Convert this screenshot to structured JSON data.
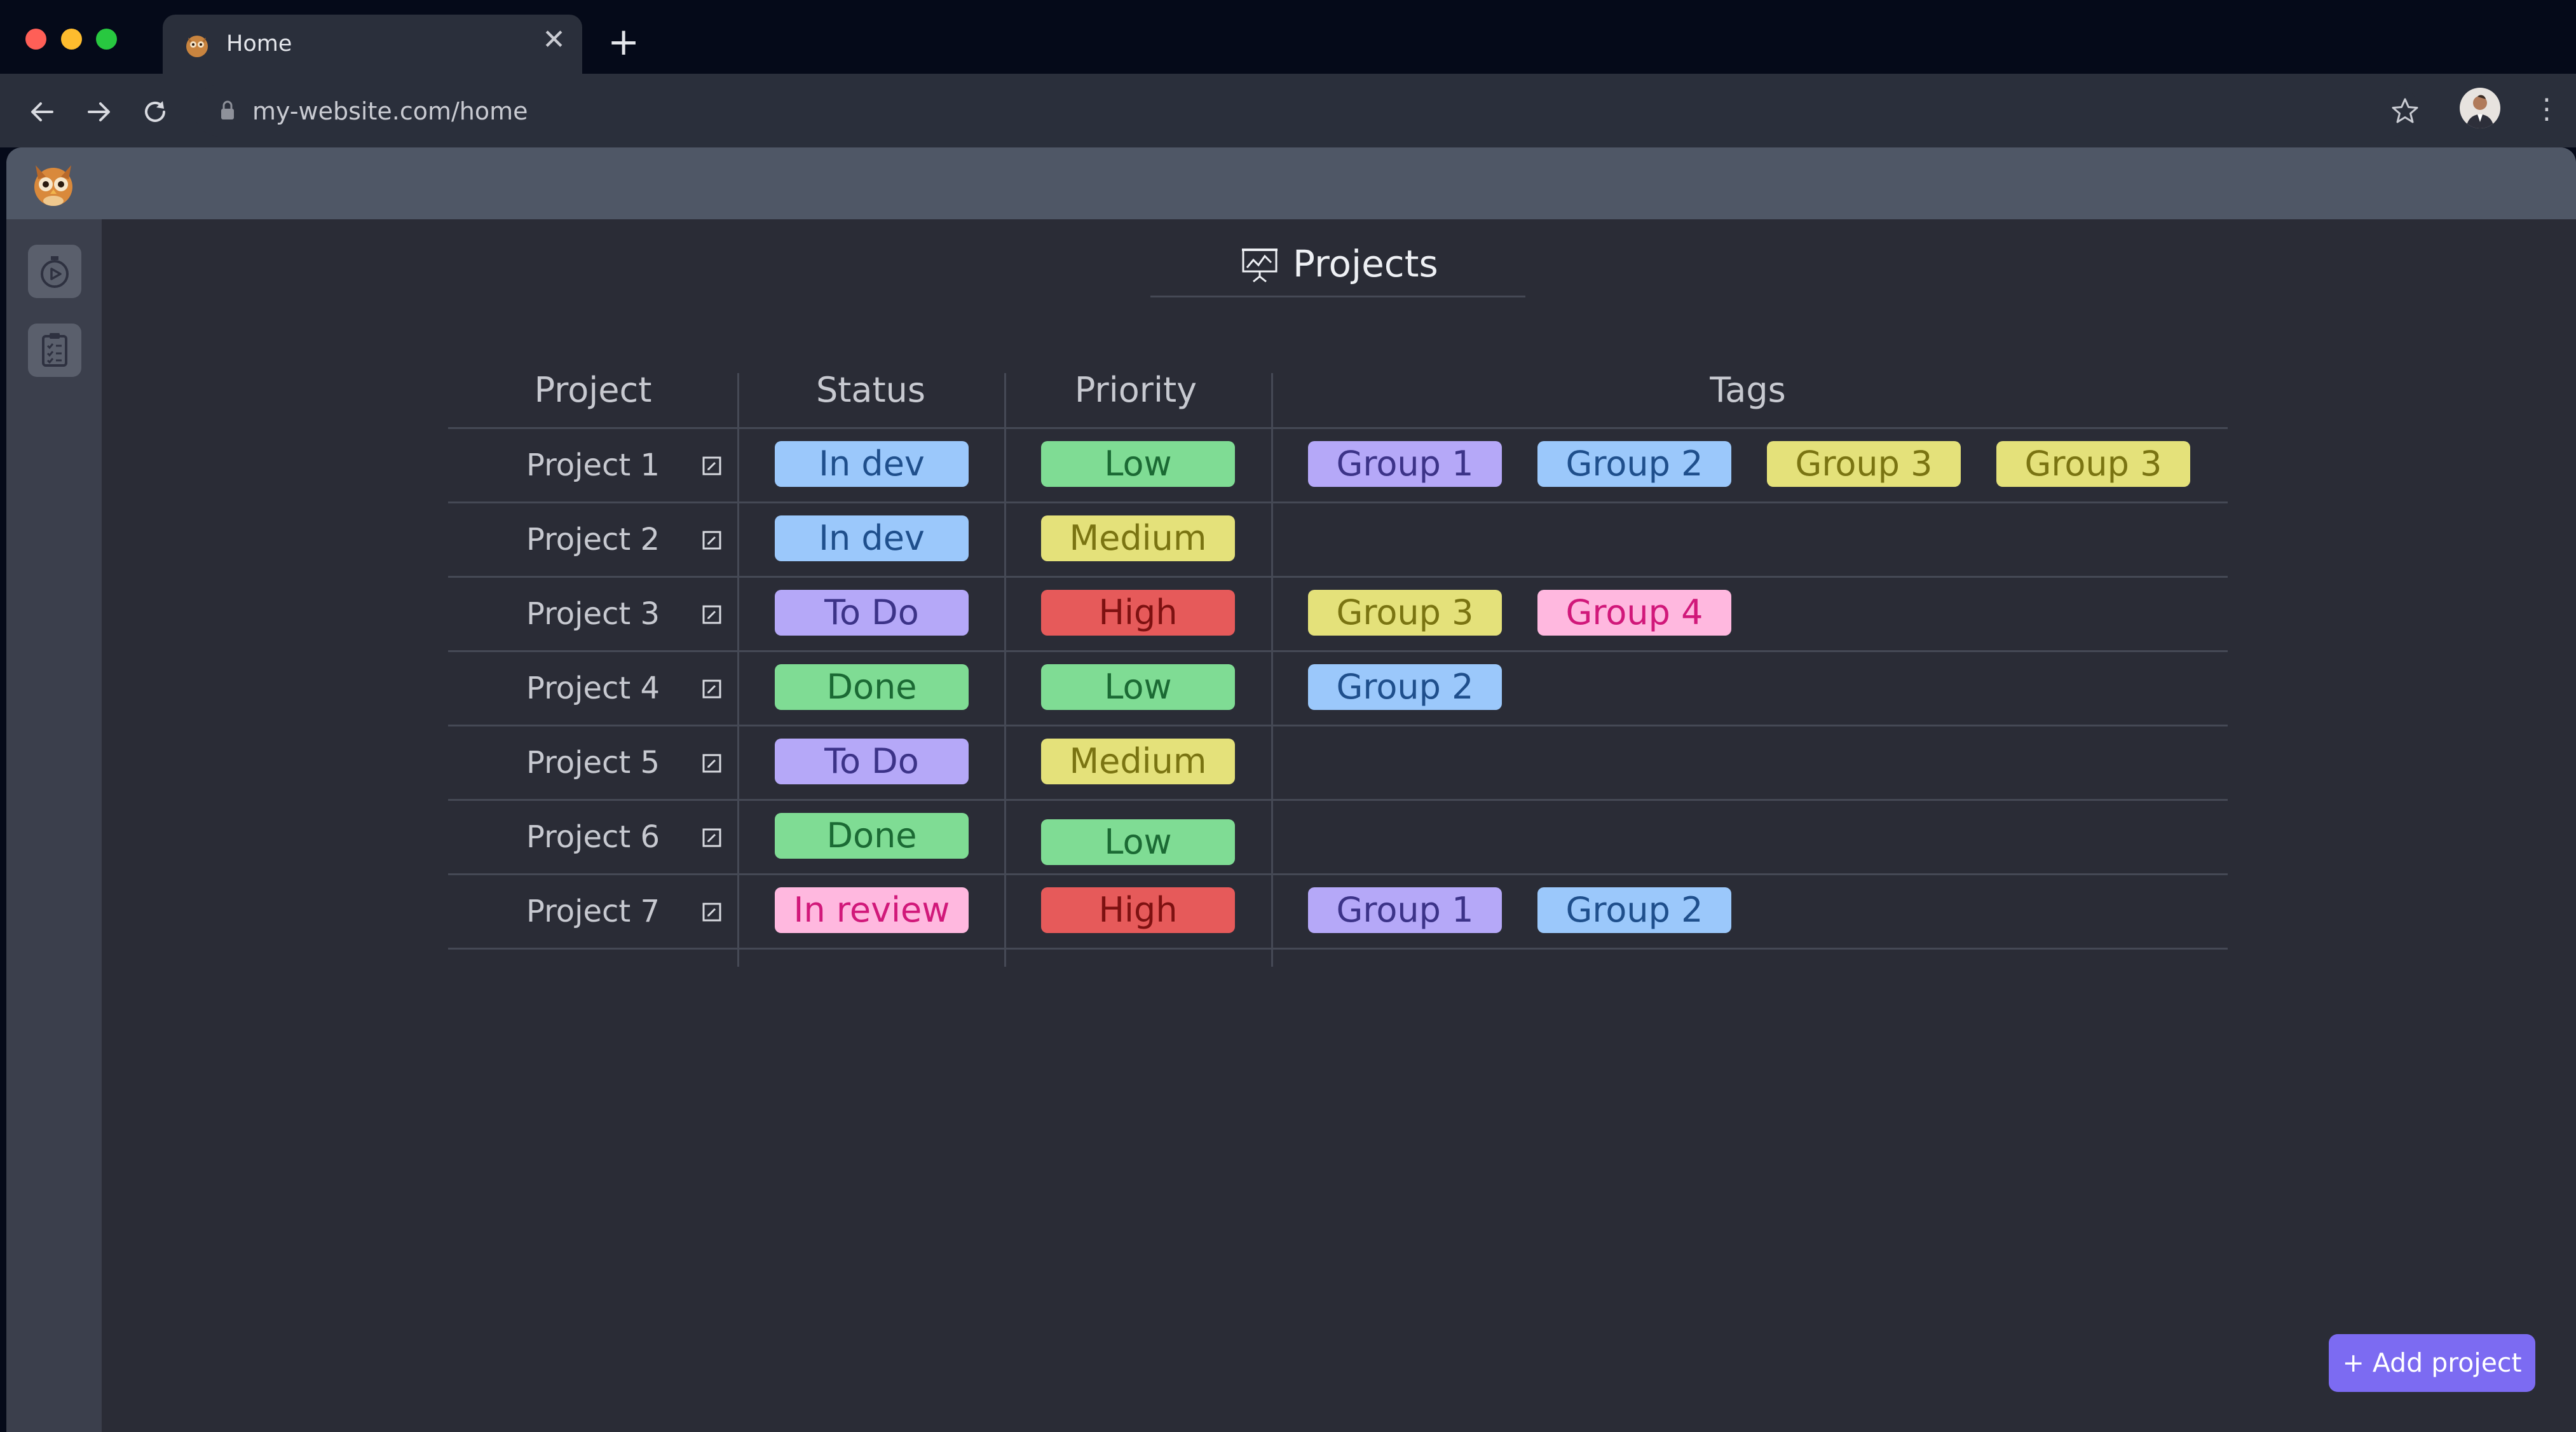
{
  "browser": {
    "tab_title": "Home",
    "tab_close": "✕",
    "new_tab": "+",
    "url": "my-website.com/home",
    "menu": "⋮"
  },
  "page": {
    "title": "Projects",
    "title_icon": "chart-presentation-icon"
  },
  "table": {
    "headers": [
      "Project",
      "Status",
      "Priority",
      "Tags"
    ],
    "rows": [
      {
        "name": "Project 1",
        "status": "In dev",
        "priority": "Low",
        "tags": [
          "Group 1",
          "Group 2",
          "Group 3",
          "Group 3"
        ]
      },
      {
        "name": "Project 2",
        "status": "In dev",
        "priority": "Medium",
        "tags": []
      },
      {
        "name": "Project 3",
        "status": "To Do",
        "priority": "High",
        "tags": [
          "Group 3",
          "Group 4"
        ]
      },
      {
        "name": "Project 4",
        "status": "Done",
        "priority": "Low",
        "tags": [
          "Group 2"
        ]
      },
      {
        "name": "Project 5",
        "status": "To Do",
        "priority": "Medium",
        "tags": []
      },
      {
        "name": "Project 6",
        "status": "Done",
        "priority": "Low",
        "tags": []
      },
      {
        "name": "Project 7",
        "status": "In review",
        "priority": "High",
        "tags": [
          "Group 1",
          "Group 2"
        ]
      }
    ]
  },
  "colors": {
    "In dev": {
      "bg": "#9bc8fb",
      "fg": "#1f4f8c"
    },
    "To Do": {
      "bg": "#b5a8f8",
      "fg": "#3c3388"
    },
    "Done": {
      "bg": "#7fdc94",
      "fg": "#1b6a34"
    },
    "In review": {
      "bg": "#ffb8df",
      "fg": "#d1187a"
    },
    "Low": {
      "bg": "#7fdc94",
      "fg": "#1b6a34"
    },
    "Medium": {
      "bg": "#e4e17a",
      "fg": "#7a7412"
    },
    "High": {
      "bg": "#e65a5a",
      "fg": "#7d1111"
    },
    "Group 1": {
      "bg": "#b5a8f8",
      "fg": "#3c3388"
    },
    "Group 2": {
      "bg": "#9bc8fb",
      "fg": "#1f4f8c"
    },
    "Group 3": {
      "bg": "#e4e17a",
      "fg": "#7a7412"
    },
    "Group 4": {
      "bg": "#ffb8df",
      "fg": "#d1187a"
    },
    "accent": "#7c6bf2"
  },
  "actions": {
    "add_project": "+ Add project"
  },
  "sidebar": {
    "items": [
      {
        "icon": "stopwatch-icon"
      },
      {
        "icon": "clipboard-checklist-icon"
      }
    ]
  }
}
